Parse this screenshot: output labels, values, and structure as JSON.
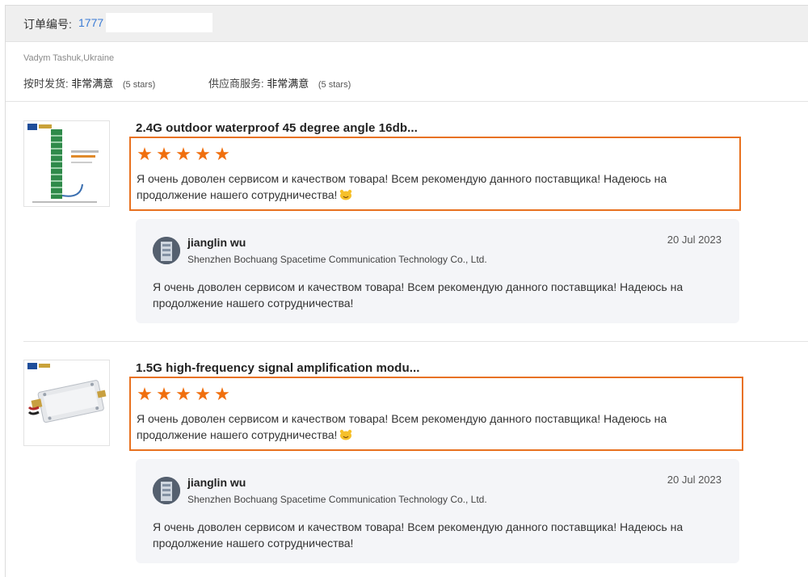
{
  "order": {
    "label": "订单编号:",
    "number": "1777"
  },
  "buyer": "Vadym Tashuk,Ukraine",
  "ratings": [
    {
      "label": "按时发货:",
      "value": "非常满意",
      "stars_text": "(5 stars)",
      "stars": 5
    },
    {
      "label": "供应商服务:",
      "value": "非常满意",
      "stars_text": "(5 stars)",
      "stars": 5
    }
  ],
  "reviews": [
    {
      "title": "2.4G outdoor waterproof 45 degree angle 16db...",
      "rating": 5,
      "text": "Я очень доволен сервисом и качеством товара! Всем рекомендую данного поставщика! Надеюсь на продолжение нашего сотрудничества!",
      "emoji": "smile-emoji",
      "reply": {
        "name": "jianglin wu",
        "company": "Shenzhen Bochuang Spacetime Communication Technology Co., Ltd.",
        "date": "20 Jul 2023",
        "text": "Я очень доволен сервисом и качеством товара! Всем рекомендую данного поставщика! Надеюсь на продолжение нашего сотрудничества!"
      }
    },
    {
      "title": "1.5G high-frequency signal amplification modu...",
      "rating": 5,
      "text": "Я очень доволен сервисом и качеством товара! Всем рекомендую данного поставщика! Надеюсь на продолжение нашего сотрудничества!",
      "emoji": "smile-emoji",
      "reply": {
        "name": "jianglin wu",
        "company": "Shenzhen Bochuang Spacetime Communication Technology Co., Ltd.",
        "date": "20 Jul 2023",
        "text": "Я очень доволен сервисом и качеством товара! Всем рекомендую данного поставщика! Надеюсь на продолжение нашего сотрудничества!"
      }
    }
  ],
  "colors": {
    "accent_orange": "#e8711f",
    "star_orange": "#f06f0e",
    "link_blue": "#3a7bd5",
    "reply_bg": "#f4f5f8"
  }
}
